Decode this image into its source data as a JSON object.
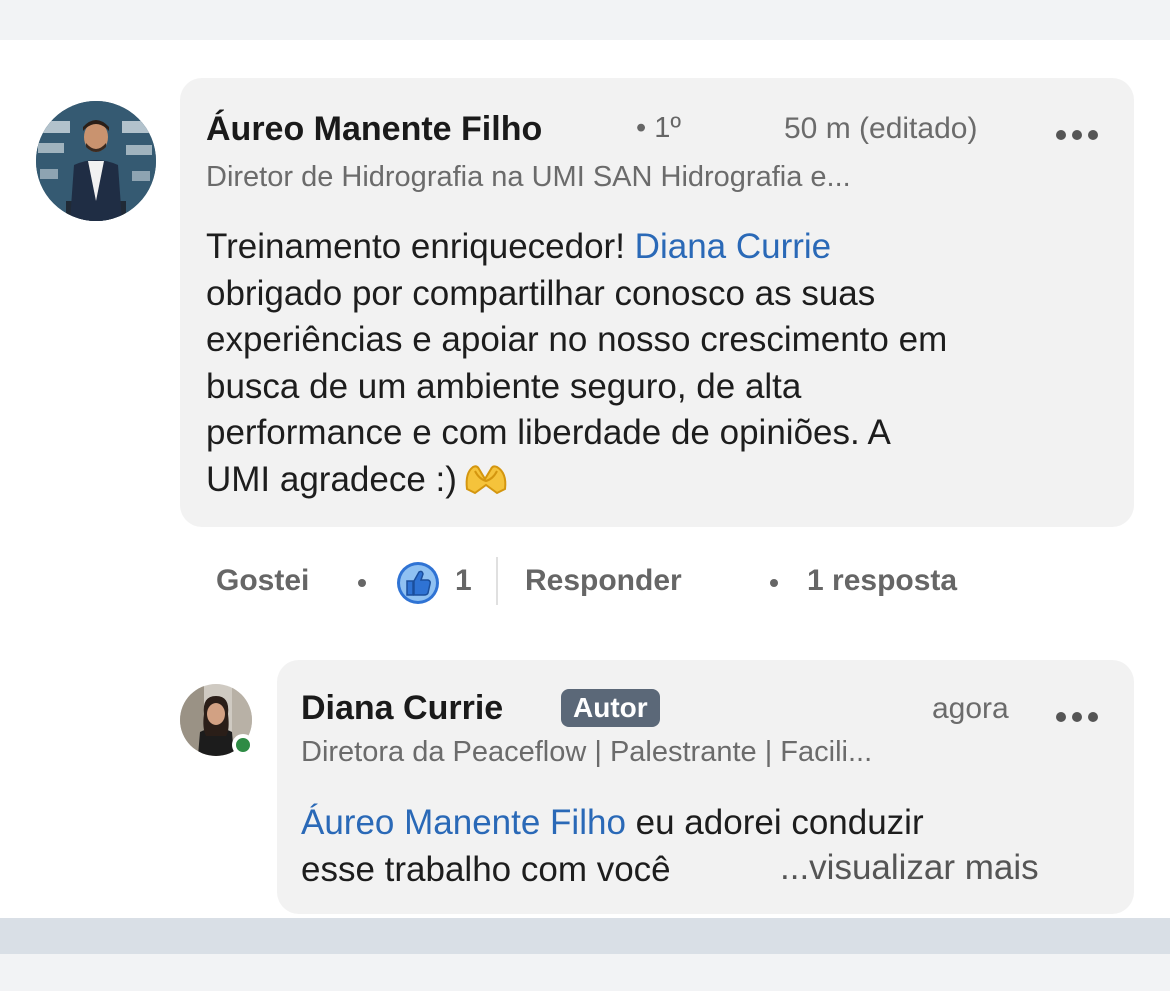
{
  "colors": {
    "mention": "#2a69b7",
    "badge_bg": "#5b6878",
    "bubble_bg": "#f2f2f2",
    "like_blue": "#2f73d4",
    "online_green": "#2e8b45"
  },
  "comment": {
    "author": "Áureo Manente Filho",
    "connection_degree": "• 1º",
    "timestamp": "50 m (editado)",
    "headline": "Diretor de Hidrografia na UMI SAN Hidrografia e...",
    "text_lines": [
      "Treinamento enriquecedor! ",
      "obrigado por compartilhar conosco as suas",
      "experiências e apoiar no nosso crescimento em",
      "busca de um ambiente seguro, de alta",
      "performance e com liberdade de opiniões. A",
      "UMI agradece :)"
    ],
    "mention": "Diana Currie",
    "emoji": "heart-hands-emoji",
    "menu_icon": "more-horizontal-icon"
  },
  "actions": {
    "like_label": "Gostei",
    "like_icon": "thumbs-up-reaction-icon",
    "like_count": "1",
    "reply_label": "Responder",
    "reply_count_label": "1 resposta"
  },
  "reply": {
    "author": "Diana Currie",
    "badge": "Autor",
    "timestamp": "agora",
    "headline": "Diretora da Peaceflow | Palestrante | Facili...",
    "mention": "Áureo Manente Filho",
    "text_after_mention": " eu adorei conduzir",
    "text_line2": "esse trabalho com você",
    "see_more": "...visualizar mais",
    "menu_icon": "more-horizontal-icon"
  }
}
